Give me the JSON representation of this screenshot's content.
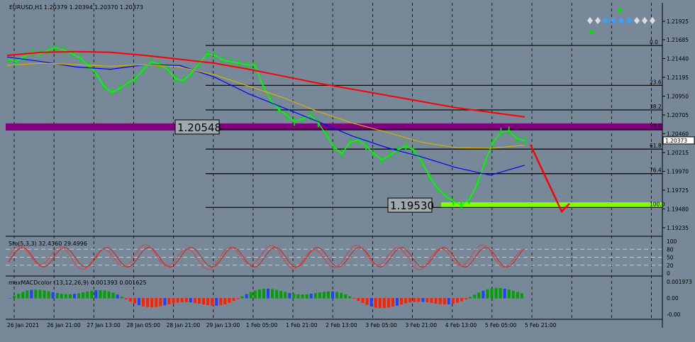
{
  "header": {
    "symbol": "EURUSD,H1",
    "ohlc": "1.20379 1.20394 1.20370 1.20373"
  },
  "chart_data": {
    "type": "line",
    "price_axis_ticks": [
      "1.21925",
      "1.21685",
      "1.21440",
      "1.21195",
      "1.20950",
      "1.20705",
      "1.20460",
      "1.20215",
      "1.19970",
      "1.19725",
      "1.19480",
      "1.19235"
    ],
    "current_price": "1.20373",
    "ylim": [
      1.19235,
      1.21925
    ],
    "time_axis_ticks": [
      "26 Jan 2021",
      "26 Jan 21:00",
      "27 Jan 13:00",
      "28 Jan 05:00",
      "28 Jan 21:00",
      "29 Jan 13:00",
      "1 Feb 05:00",
      "1 Feb 21:00",
      "2 Feb 13:00",
      "3 Feb 05:00",
      "3 Feb 21:00",
      "4 Feb 13:00",
      "5 Feb 05:00",
      "5 Feb 21:00"
    ],
    "fibonacci_levels": [
      {
        "label": "0.0",
        "price": 1.2161
      },
      {
        "label": "23.6",
        "price": 1.2109
      },
      {
        "label": "38.2",
        "price": 1.2077
      },
      {
        "label": "50.0",
        "price": 1.2052
      },
      {
        "label": "61.8",
        "price": 1.2026
      },
      {
        "label": "76.4",
        "price": 1.1994
      },
      {
        "label": "100.0",
        "price": 1.195
      }
    ],
    "annotations": [
      {
        "text": "1.20548",
        "price": 1.20548,
        "color": "#800080"
      },
      {
        "text": "1.19530",
        "price": 1.1953,
        "color": "#7fff00"
      }
    ],
    "price_series": [
      1.2143,
      1.214,
      1.2147,
      1.2152,
      1.215,
      1.2155,
      1.2158,
      1.2155,
      1.215,
      1.2145,
      1.2135,
      1.2125,
      1.2108,
      1.21,
      1.2105,
      1.2112,
      1.2118,
      1.213,
      1.214,
      1.2136,
      1.213,
      1.2118,
      1.2115,
      1.2125,
      1.2138,
      1.215,
      1.2148,
      1.2142,
      1.214,
      1.2138,
      1.2136,
      1.2135,
      1.211,
      1.209,
      1.2078,
      1.207,
      1.2062,
      1.2065,
      1.207,
      1.206,
      1.2045,
      1.2028,
      1.202,
      1.2035,
      1.2038,
      1.203,
      1.202,
      1.2012,
      1.2018,
      1.2025,
      1.203,
      1.2025,
      1.201,
      1.199,
      1.1975,
      1.1965,
      1.1958,
      1.1953,
      1.196,
      1.198,
      1.201,
      1.2035,
      1.2048,
      1.205,
      1.204,
      1.2037
    ],
    "moving_averages": [
      {
        "color": "#ff0000",
        "values": [
          1.2148,
          1.2152,
          1.2153,
          1.2152,
          1.2148,
          1.2143,
          1.2138,
          1.213,
          1.2121,
          1.2112,
          1.2104,
          1.2096,
          1.2088,
          1.208,
          1.2074,
          1.2068
        ]
      },
      {
        "color": "#0000ff",
        "values": [
          1.2146,
          1.214,
          1.2133,
          1.213,
          1.2136,
          1.2135,
          1.212,
          1.2098,
          1.208,
          1.2062,
          1.2043,
          1.2028,
          1.2016,
          1.2002,
          1.1992,
          1.2005
        ]
      },
      {
        "color": "#d4b100",
        "values": [
          1.2135,
          1.2138,
          1.2136,
          1.2134,
          1.2136,
          1.2133,
          1.2123,
          1.2108,
          1.2093,
          1.2075,
          1.206,
          1.2048,
          1.2035,
          1.2028,
          1.2027,
          1.2031
        ]
      }
    ],
    "stochastic": {
      "label": "Sto(5,3,3) 32.4360 29.4996",
      "levels": [
        "100",
        "80",
        "50",
        "20",
        "0"
      ]
    },
    "macd": {
      "label": "maxMACDcolor (13,12,26,9) 0.001393 0.001625",
      "ticks": [
        "0.001973",
        "0.00",
        "-0.00"
      ]
    }
  }
}
